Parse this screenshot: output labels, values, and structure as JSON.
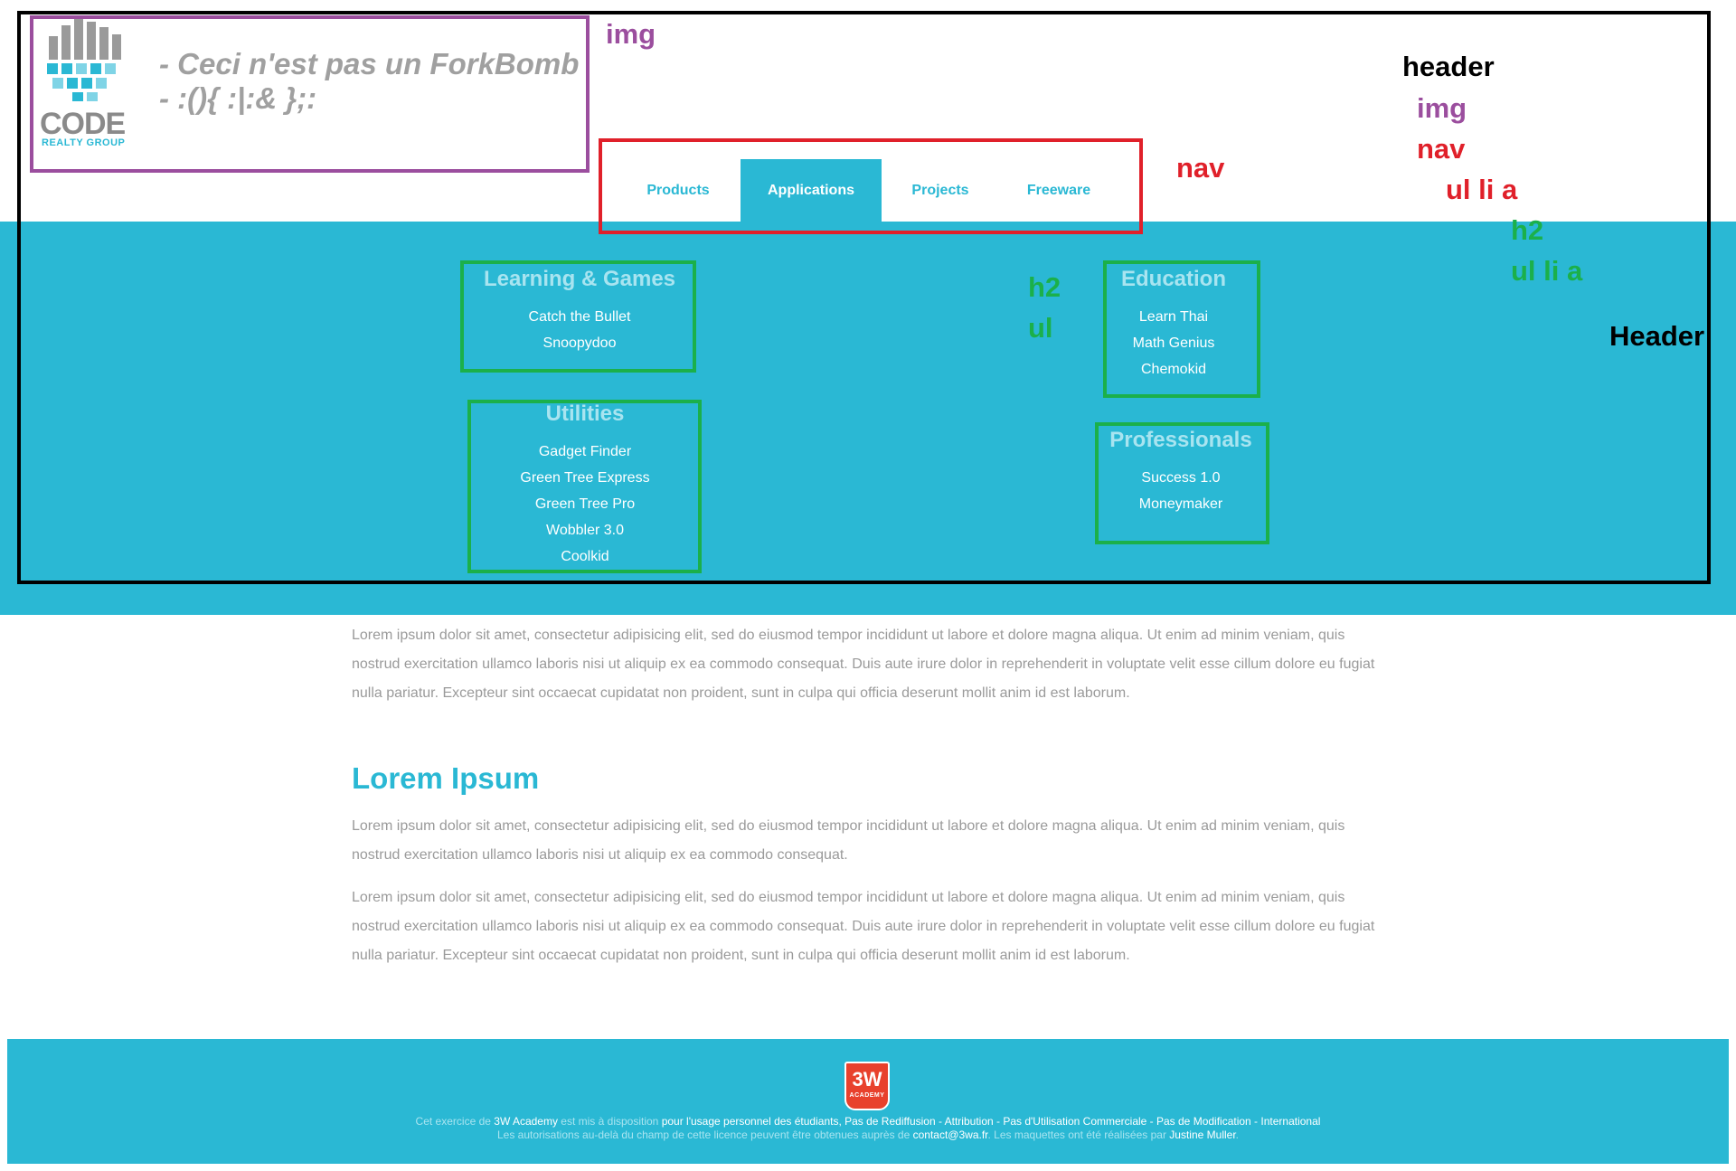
{
  "colors": {
    "accent": "#2ab8d4",
    "annotation_header": "#000000",
    "annotation_img": "#9b4e9e",
    "annotation_nav": "#e0202a",
    "annotation_list": "#1bb04a"
  },
  "logo": {
    "icon": "code-realty-logo-icon",
    "name": "CODE",
    "subtitle": "REALTY GROUP"
  },
  "tagline": "- Ceci n'est pas un ForkBomb - :(){ :|:& };:",
  "nav": {
    "items": [
      "Products",
      "Applications",
      "Projects",
      "Freeware"
    ],
    "active": "Applications"
  },
  "submenu": {
    "groups": [
      {
        "title": "Learning & Games",
        "items": [
          "Catch the Bullet",
          "Snoopydoo"
        ]
      },
      {
        "title": "Education",
        "items": [
          "Learn Thai",
          "Math Genius",
          "Chemokid"
        ]
      },
      {
        "title": "Utilities",
        "items": [
          "Gadget Finder",
          "Green Tree Express",
          "Green Tree Pro",
          "Wobbler 3.0",
          "Coolkid"
        ]
      },
      {
        "title": "Professionals",
        "items": [
          "Success 1.0",
          "Moneymaker"
        ]
      }
    ]
  },
  "annotations": {
    "img_label": "img",
    "nav_label": "nav",
    "h2_label": "h2",
    "ul_label": "ul",
    "header_label": "Header",
    "legend": {
      "header": "header",
      "img": "img",
      "nav": "nav",
      "ul_li_a": "ul li a",
      "h2": "h2",
      "ul_li_a_2": "ul li a"
    }
  },
  "content": {
    "intro": "Lorem ipsum dolor sit amet, consectetur adipisicing elit, sed do eiusmod tempor incididunt ut labore et dolore magna aliqua. Ut enim ad minim veniam, quis nostrud exercitation ullamco laboris nisi ut aliquip ex ea commodo consequat. Duis aute irure dolor in reprehenderit in voluptate velit esse cillum dolore eu fugiat nulla pariatur. Excepteur sint occaecat cupidatat non proident, sunt in culpa qui officia deserunt mollit anim id est laborum.",
    "heading": "Lorem Ipsum",
    "para1": "Lorem ipsum dolor sit amet, consectetur adipisicing elit, sed do eiusmod tempor incididunt ut labore et dolore magna aliqua. Ut enim ad minim veniam, quis nostrud exercitation ullamco laboris nisi ut aliquip ex ea commodo consequat.",
    "para2": "Lorem ipsum dolor sit amet, consectetur adipisicing elit, sed do eiusmod tempor incididunt ut labore et dolore magna aliqua. Ut enim ad minim veniam, quis nostrud exercitation ullamco laboris nisi ut aliquip ex ea commodo consequat. Duis aute irure dolor in reprehenderit in voluptate velit esse cillum dolore eu fugiat nulla pariatur. Excepteur sint occaecat cupidatat non proident, sunt in culpa qui officia deserunt mollit anim id est laborum."
  },
  "footer": {
    "badge_big": "3W",
    "badge_small": "ACADEMY",
    "line1": {
      "a": "Cet exercice de ",
      "b": "3W Academy",
      "c": " est mis à disposition ",
      "d": "pour l'usage personnel des étudiants, Pas de Rediffusion - Attribution - Pas d'Utilisation Commerciale - Pas de Modification - International"
    },
    "line2": {
      "a": "Les autorisations au-delà du champ de cette licence peuvent être obtenues auprès de ",
      "b": "contact@3wa.fr",
      "c": ". Les maquettes ont été réalisées par ",
      "d": "Justine Muller",
      "e": "."
    }
  }
}
